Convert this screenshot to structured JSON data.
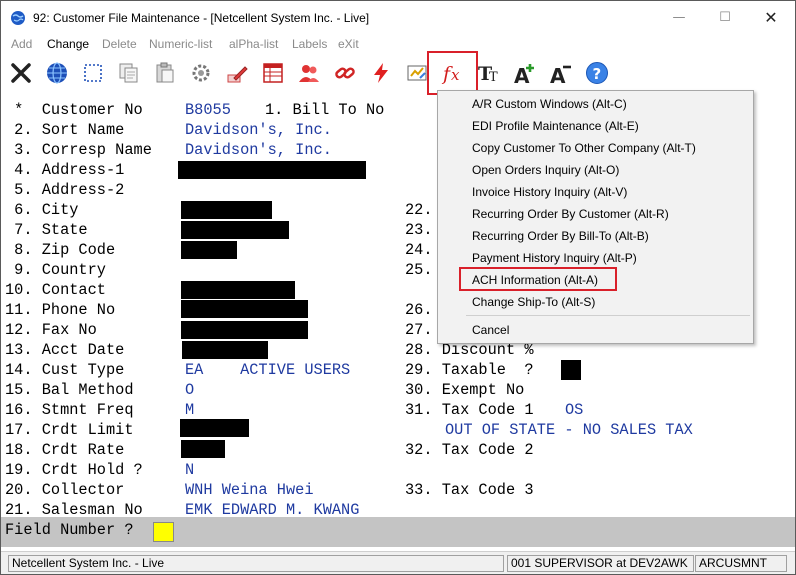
{
  "window": {
    "title": "92: Customer File Maintenance - [Netcellent System Inc. - Live]",
    "minimize": "—",
    "maximize": "☐",
    "close": "✕"
  },
  "menu": {
    "items": [
      "Add",
      "Change",
      "Delete",
      "Numeric-list",
      "alPha-list",
      "Labels",
      "eXit"
    ],
    "active": "Change"
  },
  "toolbar": {
    "icons": [
      "exit-icon",
      "globe-icon",
      "select-icon",
      "copy-icon",
      "paste-icon",
      "settings-icon",
      "edit-icon",
      "table-icon",
      "users-icon",
      "link-icon",
      "lightning-icon",
      "report-icon",
      "function-icon",
      "font-icon",
      "font-increase-icon",
      "font-decrease-icon",
      "help-icon"
    ],
    "highlighted": "function-icon"
  },
  "form": {
    "customer_no_label": " *  Customer No",
    "customer_no_value": "B8055",
    "bill_to_label": "1. Bill To No",
    "fields": [
      {
        "label": " 2. Sort Name",
        "value": "Davidson's, Inc."
      },
      {
        "label": " 3. Corresp Name",
        "value": "Davidson's, Inc."
      },
      {
        "label": " 4. Address-1",
        "value": ""
      },
      {
        "label": " 5. Address-2",
        "value": ""
      },
      {
        "label": " 6. City",
        "value": ""
      },
      {
        "label": " 7. State",
        "value": ""
      },
      {
        "label": " 8. Zip Code",
        "value": ""
      },
      {
        "label": " 9. Country",
        "value": ""
      },
      {
        "label": "10. Contact",
        "value": ""
      },
      {
        "label": "11. Phone No",
        "value": ""
      },
      {
        "label": "12. Fax No",
        "value": ""
      },
      {
        "label": "13. Acct Date",
        "value": ""
      },
      {
        "label": "14. Cust Type",
        "value": "EA    ACTIVE USERS"
      },
      {
        "label": "15. Bal Method",
        "value": "O"
      },
      {
        "label": "16. Stmnt Freq",
        "value": "M"
      },
      {
        "label": "17. Crdt Limit",
        "value": ""
      },
      {
        "label": "18. Crdt Rate",
        "value": ""
      },
      {
        "label": "19. Crdt Hold ?",
        "value": "N"
      },
      {
        "label": "20. Collector",
        "value": "WNH Weina Hwei"
      },
      {
        "label": "21. Salesman No",
        "value": "EMK EDWARD M. KWANG"
      }
    ],
    "right_fields": [
      {
        "label": "22.",
        "value": ""
      },
      {
        "label": "23.",
        "value": ""
      },
      {
        "label": "24.",
        "value": ""
      },
      {
        "label": "25.",
        "value": ""
      },
      {
        "label": "26.",
        "value": ""
      },
      {
        "label": "27.",
        "value": ""
      },
      {
        "label": "28. Discount %",
        "value": ""
      },
      {
        "label": "29. Taxable  ?",
        "value": ""
      },
      {
        "label": "30. Exempt No",
        "value": ""
      },
      {
        "label": "31. Tax Code 1",
        "value": "OS"
      },
      {
        "label": "",
        "value": "OUT OF STATE - NO SALES TAX"
      },
      {
        "label": "32. Tax Code 2",
        "value": ""
      },
      {
        "label": "33. Tax Code 3",
        "value": ""
      }
    ]
  },
  "prompt": {
    "label": "Field Number ?",
    "value": ""
  },
  "context_menu": {
    "items": [
      "A/R Custom Windows  (Alt-C)",
      "EDI Profile Maintenance  (Alt-E)",
      "Copy Customer To Other Company  (Alt-T)",
      "Open Orders Inquiry  (Alt-O)",
      "Invoice History Inquiry  (Alt-V)",
      "Recurring Order By Customer  (Alt-R)",
      "Recurring Order By Bill-To  (Alt-B)",
      "Payment History Inquiry  (Alt-P)",
      "ACH Information  (Alt-A)",
      "Change Ship-To  (Alt-S)"
    ],
    "cancel": "Cancel",
    "highlighted": "ACH Information  (Alt-A)"
  },
  "status": {
    "company": "Netcellent System Inc. - Live",
    "user": "001 SUPERVISOR at DEV2AWK",
    "program": "ARCUSMNT"
  },
  "colors": {
    "value_text": "#1f3aa0",
    "prompt_input": "#ffff00",
    "highlight_box": "#d9202a"
  }
}
